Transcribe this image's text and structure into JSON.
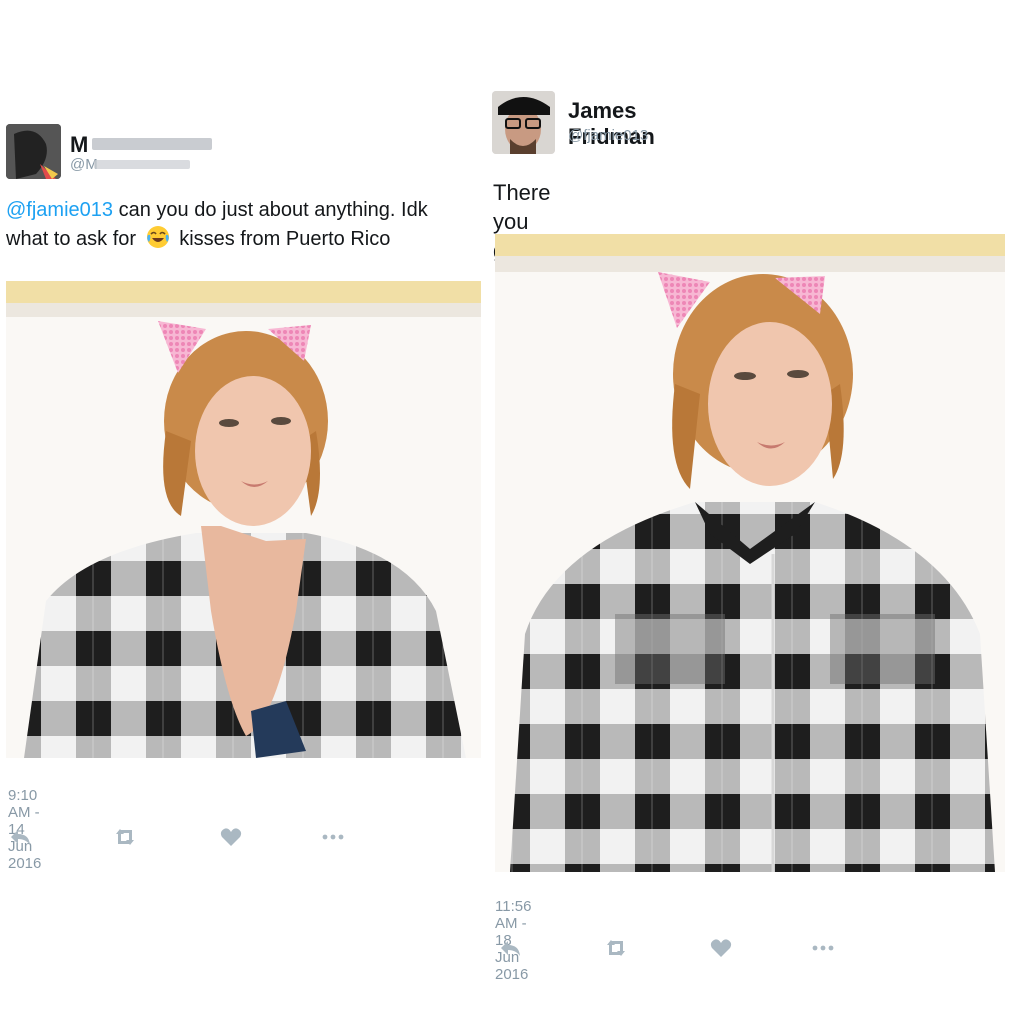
{
  "left_tweet": {
    "name": "M",
    "handle": "@M",
    "text_mention": "@fjamie013",
    "text_part1": " can you do just about anything. Idk",
    "text_part2": "what to ask for",
    "emoji": "face-with-tears-of-joy",
    "text_part3": "kisses from Puerto Rico",
    "timestamp": "9:10 AM - 14 Jun 2016",
    "icons": [
      "reply-icon",
      "retweet-icon",
      "like-icon",
      "more-icon"
    ]
  },
  "right_tweet": {
    "name": "James Fridman",
    "handle": "@fjamie013",
    "text": "There you go.",
    "timestamp": "11:56 AM - 18 Jun 2016",
    "icons": [
      "reply-icon",
      "retweet-icon",
      "like-icon",
      "more-icon"
    ]
  },
  "colors": {
    "mention": "#1da1f2",
    "secondary": "#8899a6",
    "icon": "#aab8c2",
    "plaid_dark": "#1e1e1e",
    "plaid_light": "#f2f2f2",
    "hair": "#c98a4a",
    "ears": "#f3a6c8"
  }
}
